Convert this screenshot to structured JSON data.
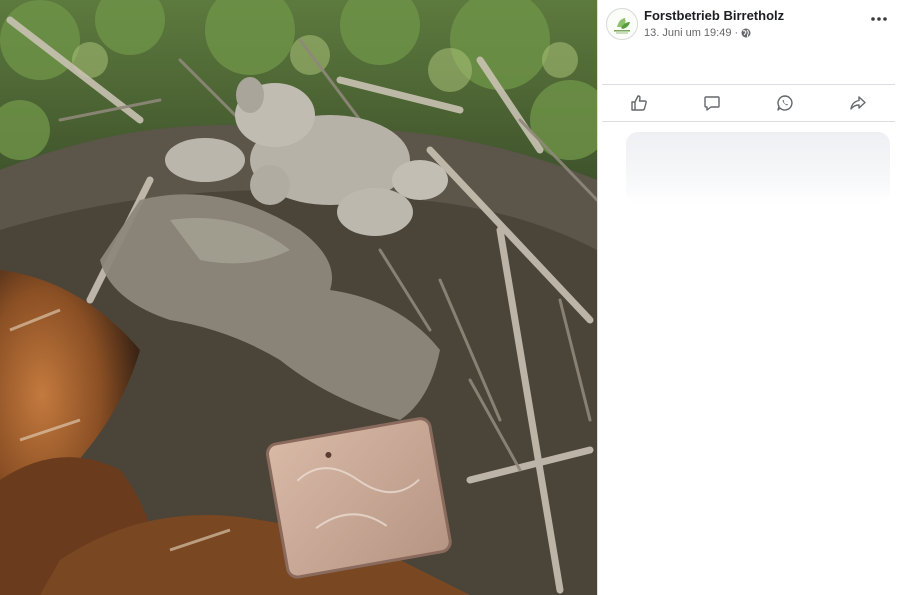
{
  "post": {
    "page_name": "Forstbetrieb Birretholz",
    "timestamp": "13. Juni um 19:49",
    "separator": "·",
    "privacy_icon": "globe-icon",
    "avatar_icon": "forest-logo-icon"
  },
  "photo": {
    "subject_icons": [
      "plush-toy",
      "cloth",
      "phone-case",
      "bird-feathers",
      "stick-nest"
    ]
  },
  "actions": [
    {
      "icon": "like-icon"
    },
    {
      "icon": "comment-icon"
    },
    {
      "icon": "whatsapp-icon"
    },
    {
      "icon": "share-icon"
    }
  ],
  "colors": {
    "page_name": "#1c1e21",
    "meta": "#65676b",
    "icon": "#65676b",
    "divider": "#dadde1"
  }
}
